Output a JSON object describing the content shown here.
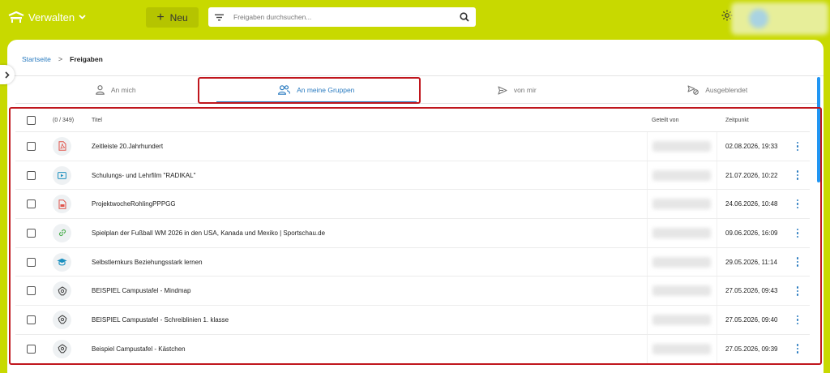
{
  "topbar": {
    "brand_label": "Verwalten",
    "new_label": "Neu",
    "search_placeholder": "Freigaben durchsuchen..."
  },
  "breadcrumb": {
    "home": "Startseite",
    "current": "Freigaben"
  },
  "tabs": [
    {
      "label": "An mich",
      "icon": "person-icon",
      "active": false
    },
    {
      "label": "An meine Gruppen",
      "icon": "group-icon",
      "active": true
    },
    {
      "label": "von mir",
      "icon": "send-icon",
      "active": false
    },
    {
      "label": "Ausgeblendet",
      "icon": "hidden-share-icon",
      "active": false
    }
  ],
  "table": {
    "count": "(0 / 349)",
    "headers": {
      "title": "Titel",
      "shared_by": "Geteilt von",
      "time": "Zeitpunkt"
    },
    "rows": [
      {
        "type": "pdf",
        "title": "Zeitleiste 20.Jahrhundert",
        "time": "02.08.2026, 19:33"
      },
      {
        "type": "video",
        "title": "Schulungs- und Lehrfilm \"RADIKAL\"",
        "time": "21.07.2026, 10:22"
      },
      {
        "type": "pdf-doc",
        "title": "ProjektwocheRohlingPPPGG",
        "time": "24.06.2026, 10:48"
      },
      {
        "type": "link",
        "title": "Spielplan der Fußball WM 2026 in den USA, Kanada und Mexiko | Sportschau.de",
        "time": "09.06.2026, 16:09"
      },
      {
        "type": "course",
        "title": "Selbstlernkurs Beziehungsstark lernen",
        "time": "29.05.2026, 11:14"
      },
      {
        "type": "board",
        "title": "BEISPIEL Campustafel - Mindmap",
        "time": "27.05.2026, 09:43"
      },
      {
        "type": "board",
        "title": "BEISPIEL Campustafel - Schreiblinien 1. klasse",
        "time": "27.05.2026, 09:40"
      },
      {
        "type": "board",
        "title": "Beispiel Campustafel - Kästchen",
        "time": "27.05.2026, 09:39"
      }
    ]
  },
  "colors": {
    "topbar": "#c8d900",
    "accent": "#2a7bc0",
    "highlight": "#c0161d",
    "pdf": "#e0544b"
  }
}
